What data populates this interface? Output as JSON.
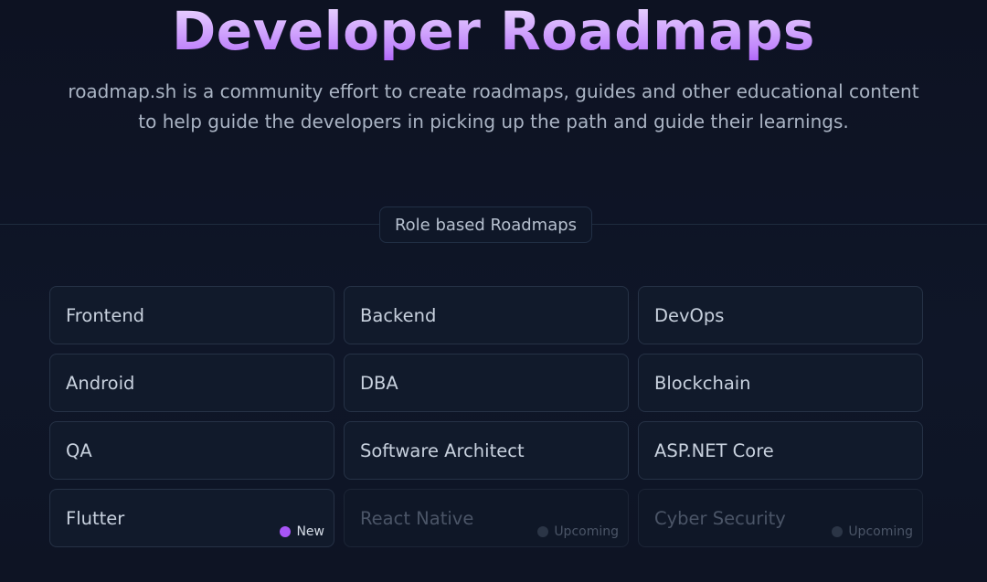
{
  "hero": {
    "title": "Developer Roadmaps",
    "subtitle_line1": "roadmap.sh is a community effort to create roadmaps, guides and other educational content",
    "subtitle_line2": "to help guide the developers in picking up the path and guide their learnings."
  },
  "section": {
    "label": "Role based Roadmaps"
  },
  "roadmaps": [
    {
      "label": "Frontend"
    },
    {
      "label": "Backend"
    },
    {
      "label": "DevOps"
    },
    {
      "label": "Android"
    },
    {
      "label": "DBA"
    },
    {
      "label": "Blockchain"
    },
    {
      "label": "QA"
    },
    {
      "label": "Software Architect"
    },
    {
      "label": "ASP.NET Core"
    },
    {
      "label": "Flutter",
      "badge": "New"
    },
    {
      "label": "React Native",
      "badge": "Upcoming"
    },
    {
      "label": "Cyber Security",
      "badge": "Upcoming"
    }
  ],
  "colors": {
    "background": "#0d1222",
    "title_gradient_start": "#f3e8ff",
    "title_gradient_end": "#a855f7",
    "new_badge_dot": "#a855f7",
    "upcoming_badge_dot": "#2b3546"
  }
}
